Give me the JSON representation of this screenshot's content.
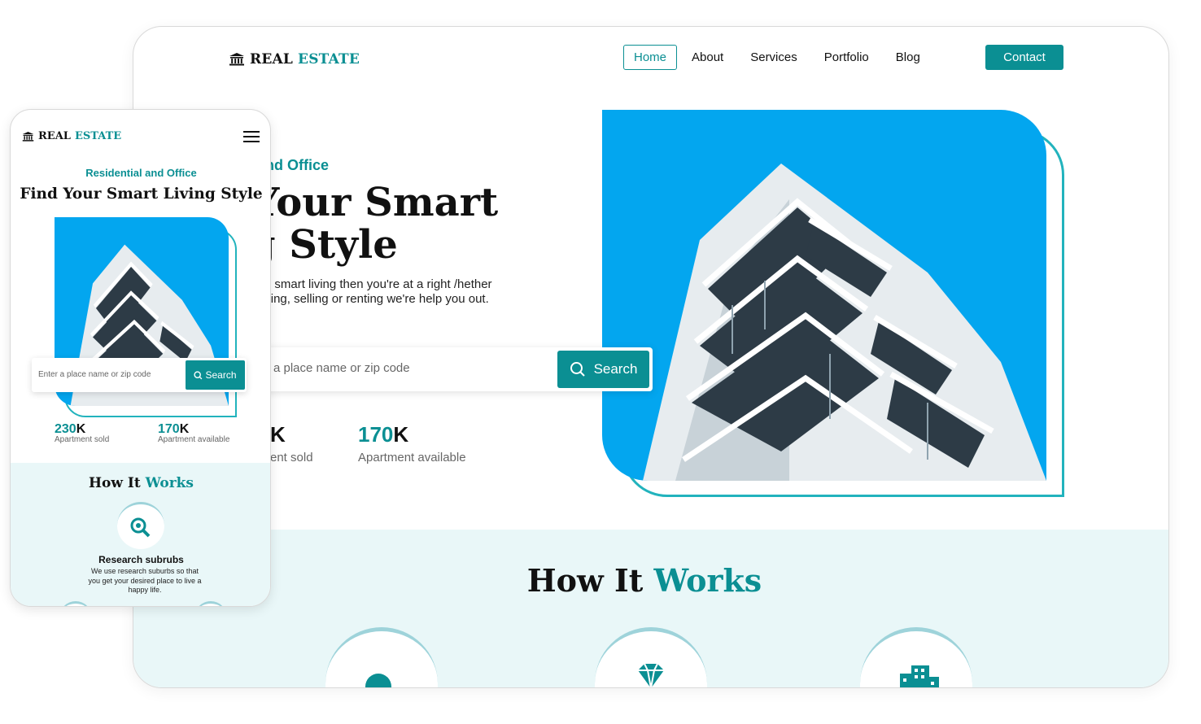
{
  "brand": {
    "part1": "REAL",
    "part2": "ESTATE"
  },
  "nav": {
    "items": [
      "Home",
      "About",
      "Services",
      "Portfolio",
      "Blog"
    ],
    "contact": "Contact"
  },
  "hero": {
    "tag": "ential and Office",
    "title": "nd Your Smart ving Style",
    "desc": " looking for smart living then you're at a right /hether you're buying, selling or renting we're help you out.",
    "search_placeholder": "a place name or zip code",
    "search_button": "Search",
    "stats": [
      {
        "num": "K",
        "label": "ent sold"
      },
      {
        "num": "170",
        "suffix": "K",
        "label": "Apartment available"
      }
    ]
  },
  "how": {
    "part1": "How It ",
    "part2": "Works"
  },
  "mobile": {
    "tag": "Residential and Office",
    "title": "Find Your Smart Living Style",
    "search_placeholder": "Enter a place name or zip code",
    "search_button": "Search",
    "stats": [
      {
        "num": "230",
        "suffix": "K",
        "label": "Apartment sold"
      },
      {
        "num": "170",
        "suffix": "K",
        "label": "Apartment available"
      }
    ],
    "how": {
      "part1": "How It ",
      "part2": "Works"
    },
    "step1": {
      "title": "Research subrubs",
      "desc": "We use research suburbs so that you get your desired place to live a happy life."
    }
  },
  "colors": {
    "accent": "#0b8f93",
    "sky": "#03a6ef",
    "band": "#e9f7f8",
    "outline": "#22b3bd"
  },
  "icons": [
    "bank-icon",
    "search-icon",
    "hamburger-menu-icon",
    "search-zoom-icon",
    "diamond-icon",
    "building-icon"
  ]
}
